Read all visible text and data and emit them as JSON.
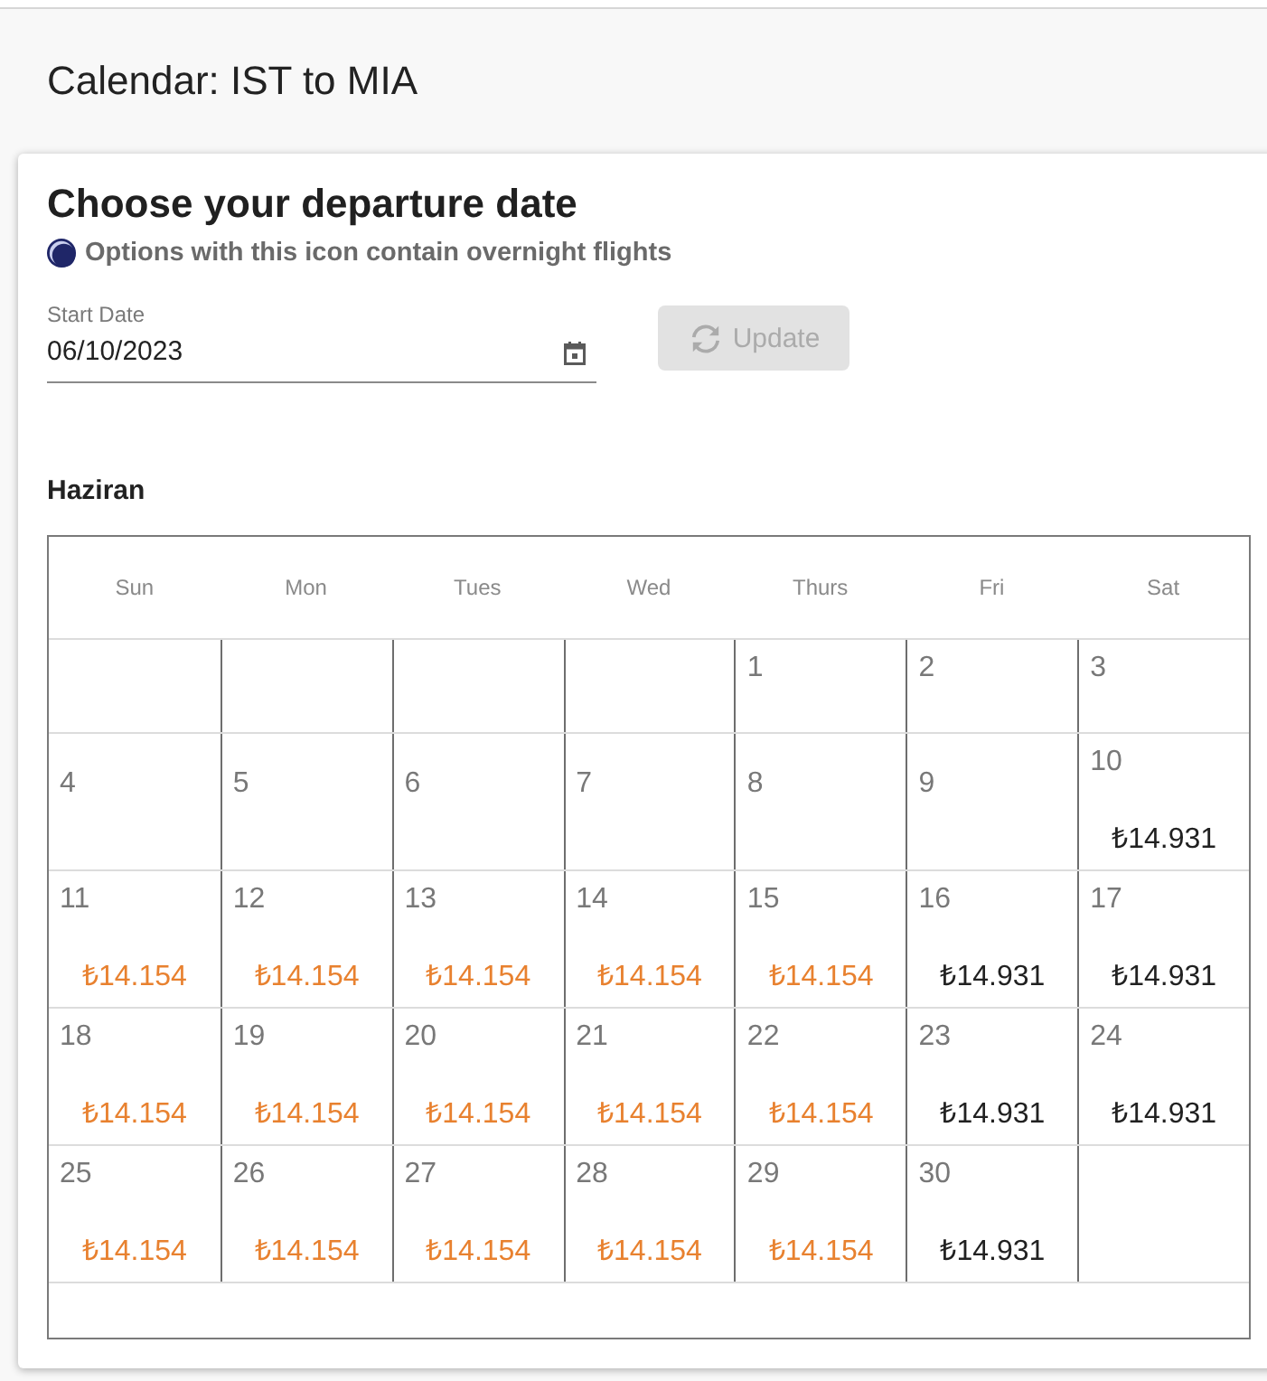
{
  "page": {
    "title": "Calendar: IST to MIA"
  },
  "card": {
    "heading": "Choose your departure date",
    "legend": "Options with this icon contain overnight flights"
  },
  "start_date": {
    "label": "Start Date",
    "value": "06/10/2023"
  },
  "update_button": {
    "label": "Update",
    "disabled": true
  },
  "calendar": {
    "month": "Haziran",
    "weekdays": [
      "Sun",
      "Mon",
      "Tues",
      "Wed",
      "Thurs",
      "Fri",
      "Sat"
    ],
    "weeks": [
      {
        "days": [
          {
            "kind": "blank"
          },
          {
            "kind": "blank"
          },
          {
            "kind": "blank"
          },
          {
            "kind": "blank"
          },
          {
            "kind": "day",
            "day": "1"
          },
          {
            "kind": "day",
            "day": "2"
          },
          {
            "kind": "day",
            "day": "3"
          }
        ]
      },
      {
        "days": [
          {
            "kind": "day",
            "day": "4"
          },
          {
            "kind": "day",
            "day": "5"
          },
          {
            "kind": "day",
            "day": "6"
          },
          {
            "kind": "day",
            "day": "7"
          },
          {
            "kind": "day",
            "day": "8"
          },
          {
            "kind": "day",
            "day": "9"
          },
          {
            "kind": "day",
            "day": "10",
            "price": "₺14.931",
            "color": "#212121"
          }
        ]
      },
      {
        "days": [
          {
            "kind": "day",
            "day": "11",
            "price": "₺14.154",
            "color": "#e8812f"
          },
          {
            "kind": "day",
            "day": "12",
            "price": "₺14.154",
            "color": "#e8812f"
          },
          {
            "kind": "day",
            "day": "13",
            "price": "₺14.154",
            "color": "#e8812f"
          },
          {
            "kind": "day",
            "day": "14",
            "price": "₺14.154",
            "color": "#e8812f"
          },
          {
            "kind": "day",
            "day": "15",
            "price": "₺14.154",
            "color": "#e8812f"
          },
          {
            "kind": "day",
            "day": "16",
            "price": "₺14.931",
            "color": "#212121"
          },
          {
            "kind": "day",
            "day": "17",
            "price": "₺14.931",
            "color": "#212121"
          }
        ]
      },
      {
        "days": [
          {
            "kind": "day",
            "day": "18",
            "price": "₺14.154",
            "color": "#e8812f"
          },
          {
            "kind": "day",
            "day": "19",
            "price": "₺14.154",
            "color": "#e8812f"
          },
          {
            "kind": "day",
            "day": "20",
            "price": "₺14.154",
            "color": "#e8812f"
          },
          {
            "kind": "day",
            "day": "21",
            "price": "₺14.154",
            "color": "#e8812f"
          },
          {
            "kind": "day",
            "day": "22",
            "price": "₺14.154",
            "color": "#e8812f"
          },
          {
            "kind": "day",
            "day": "23",
            "price": "₺14.931",
            "color": "#212121"
          },
          {
            "kind": "day",
            "day": "24",
            "price": "₺14.931",
            "color": "#212121"
          }
        ]
      },
      {
        "days": [
          {
            "kind": "day",
            "day": "25",
            "price": "₺14.154",
            "color": "#e8812f"
          },
          {
            "kind": "day",
            "day": "26",
            "price": "₺14.154",
            "color": "#e8812f"
          },
          {
            "kind": "day",
            "day": "27",
            "price": "₺14.154",
            "color": "#e8812f"
          },
          {
            "kind": "day",
            "day": "28",
            "price": "₺14.154",
            "color": "#e8812f"
          },
          {
            "kind": "day",
            "day": "29",
            "price": "₺14.154",
            "color": "#e8812f"
          },
          {
            "kind": "day",
            "day": "30",
            "price": "₺14.931",
            "color": "#212121"
          },
          {
            "kind": "blank"
          }
        ]
      }
    ]
  }
}
